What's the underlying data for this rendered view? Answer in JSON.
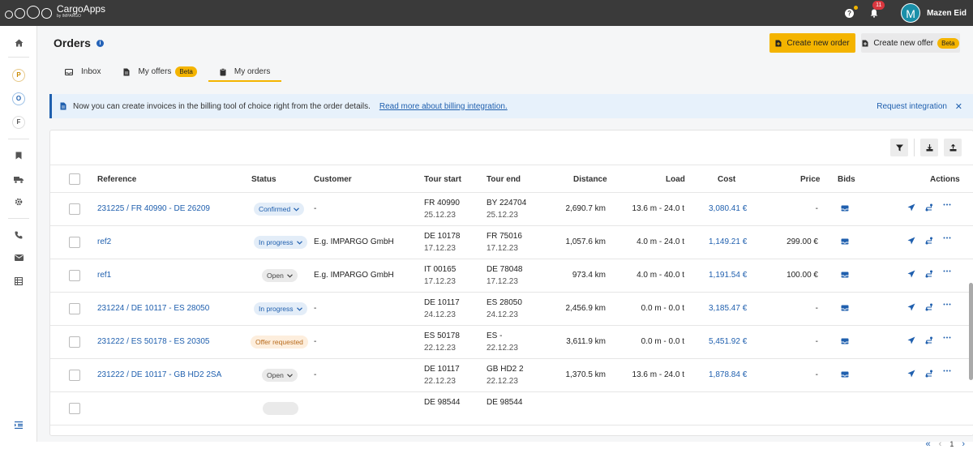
{
  "topbar": {
    "app_name": "CargoApps",
    "app_sub": "by IMPARGO",
    "help_label": "?",
    "notif_count": "11",
    "avatar_initial": "M",
    "user_name": "Mazen Eid"
  },
  "sidebar": {
    "circle_items": [
      "P",
      "O",
      "F"
    ]
  },
  "page": {
    "title": "Orders",
    "info_label": "i",
    "create_order": "Create new order",
    "create_offer": "Create new offer",
    "beta": "Beta"
  },
  "tabs": [
    {
      "label": "Inbox",
      "icon": "inbox-icon"
    },
    {
      "label": "My offers",
      "icon": "document-icon",
      "badge": "Beta"
    },
    {
      "label": "My orders",
      "icon": "clipboard-icon",
      "active": true
    }
  ],
  "banner": {
    "text": "Now you can create invoices in the billing tool of choice right from the order details.",
    "link": "Read more about billing integration.",
    "request": "Request integration",
    "close": "✕"
  },
  "table": {
    "columns": [
      "Reference",
      "Status",
      "Customer",
      "Tour start",
      "Tour end",
      "Distance",
      "Load",
      "Cost",
      "Price",
      "Bids",
      "Actions"
    ],
    "rows": [
      {
        "reference": "231225 / FR 40990 - DE 26209",
        "status": "Confirmed",
        "customer": "-",
        "start": "FR 40990",
        "start_date": "25.12.23",
        "end": "BY 224704",
        "end_date": "25.12.23",
        "distance": "2,690.7 km",
        "load": "13.6 m - 24.0 t",
        "cost": "3,080.41 €",
        "price": "-"
      },
      {
        "reference": "ref2",
        "status": "In progress",
        "customer": "E.g. IMPARGO GmbH",
        "start": "DE 10178",
        "start_date": "17.12.23",
        "end": "FR 75016",
        "end_date": "17.12.23",
        "distance": "1,057.6 km",
        "load": "4.0 m - 24.0 t",
        "cost": "1,149.21 €",
        "price": "299.00 €"
      },
      {
        "reference": "ref1",
        "status": "Open",
        "customer": "E.g. IMPARGO GmbH",
        "start": "IT 00165",
        "start_date": "17.12.23",
        "end": "DE 78048",
        "end_date": "17.12.23",
        "distance": "973.4 km",
        "load": "4.0 m - 40.0 t",
        "cost": "1,191.54 €",
        "price": "100.00 €"
      },
      {
        "reference": "231224 / DE 10117 - ES 28050",
        "status": "In progress",
        "customer": "-",
        "start": "DE 10117",
        "start_date": "24.12.23",
        "end": "ES 28050",
        "end_date": "24.12.23",
        "distance": "2,456.9 km",
        "load": "0.0 m - 0.0 t",
        "cost": "3,185.47 €",
        "price": "-"
      },
      {
        "reference": "231222 / ES 50178 - ES 20305",
        "status": "Offer requested",
        "customer": "-",
        "start": "ES 50178",
        "start_date": "22.12.23",
        "end": "ES -",
        "end_date": "22.12.23",
        "distance": "3,611.9 km",
        "load": "0.0 m - 0.0 t",
        "cost": "5,451.92 €",
        "price": "-"
      },
      {
        "reference": "231222 / DE 10117 - GB HD2 2SA",
        "status": "Open",
        "customer": "-",
        "start": "DE 10117",
        "start_date": "22.12.23",
        "end": "GB HD2 2",
        "end_date": "22.12.23",
        "distance": "1,370.5 km",
        "load": "13.6 m - 24.0 t",
        "cost": "1,878.84 €",
        "price": "-"
      },
      {
        "reference": "",
        "status": "",
        "customer": "",
        "start": "DE 98544",
        "start_date": "",
        "end": "DE 98544",
        "end_date": "",
        "distance": "",
        "load": "",
        "cost": "",
        "price": ""
      }
    ]
  },
  "pager": {
    "first": "«",
    "prev": "‹",
    "page": "1",
    "next": "›"
  },
  "colors": {
    "accent": "#f4b400",
    "link": "#1f5fae",
    "topbar": "#3a3a3a"
  }
}
